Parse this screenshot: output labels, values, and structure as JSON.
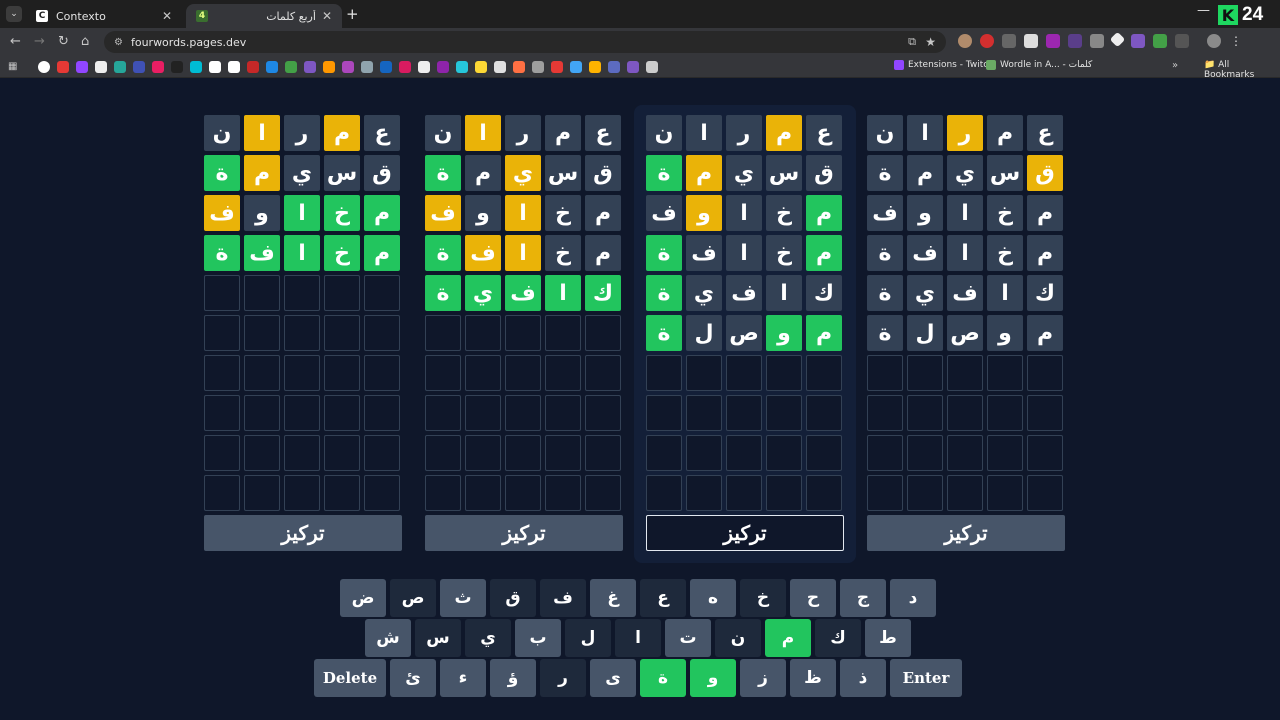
{
  "browser": {
    "tabs": [
      {
        "title": "Contexto",
        "favicon": "C",
        "active": false
      },
      {
        "title": "أربع كلمات",
        "favicon": "4",
        "active": true
      }
    ],
    "url": "fourwords.pages.dev",
    "brand_badge": {
      "letter": "K",
      "number": "24"
    },
    "bookmarks": [
      {
        "label": "Extensions - Twitch"
      },
      {
        "label": "Wordle in A... - كلمات"
      }
    ],
    "all_bookmarks": "All Bookmarks"
  },
  "colors": {
    "correct": "#22c55e",
    "present": "#eab308",
    "absent": "#334155",
    "background": "#0f172a"
  },
  "boards": [
    {
      "focus_label": "تركيز",
      "focused": false,
      "rows": [
        [
          {
            "l": "ن",
            "s": "absent"
          },
          {
            "l": "ا",
            "s": "present"
          },
          {
            "l": "ر",
            "s": "absent"
          },
          {
            "l": "م",
            "s": "present"
          },
          {
            "l": "ع",
            "s": "absent"
          }
        ],
        [
          {
            "l": "ة",
            "s": "correct"
          },
          {
            "l": "م",
            "s": "present"
          },
          {
            "l": "ي",
            "s": "absent"
          },
          {
            "l": "س",
            "s": "absent"
          },
          {
            "l": "ق",
            "s": "absent"
          }
        ],
        [
          {
            "l": "ف",
            "s": "present"
          },
          {
            "l": "و",
            "s": "absent"
          },
          {
            "l": "ا",
            "s": "correct"
          },
          {
            "l": "خ",
            "s": "correct"
          },
          {
            "l": "م",
            "s": "correct"
          }
        ],
        [
          {
            "l": "ة",
            "s": "correct"
          },
          {
            "l": "ف",
            "s": "correct"
          },
          {
            "l": "ا",
            "s": "correct"
          },
          {
            "l": "خ",
            "s": "correct"
          },
          {
            "l": "م",
            "s": "correct"
          }
        ]
      ]
    },
    {
      "focus_label": "تركيز",
      "focused": false,
      "rows": [
        [
          {
            "l": "ن",
            "s": "absent"
          },
          {
            "l": "ا",
            "s": "present"
          },
          {
            "l": "ر",
            "s": "absent"
          },
          {
            "l": "م",
            "s": "absent"
          },
          {
            "l": "ع",
            "s": "absent"
          }
        ],
        [
          {
            "l": "ة",
            "s": "correct"
          },
          {
            "l": "م",
            "s": "absent"
          },
          {
            "l": "ي",
            "s": "present"
          },
          {
            "l": "س",
            "s": "absent"
          },
          {
            "l": "ق",
            "s": "absent"
          }
        ],
        [
          {
            "l": "ف",
            "s": "present"
          },
          {
            "l": "و",
            "s": "absent"
          },
          {
            "l": "ا",
            "s": "present"
          },
          {
            "l": "خ",
            "s": "absent"
          },
          {
            "l": "م",
            "s": "absent"
          }
        ],
        [
          {
            "l": "ة",
            "s": "correct"
          },
          {
            "l": "ف",
            "s": "present"
          },
          {
            "l": "ا",
            "s": "present"
          },
          {
            "l": "خ",
            "s": "absent"
          },
          {
            "l": "م",
            "s": "absent"
          }
        ],
        [
          {
            "l": "ة",
            "s": "correct"
          },
          {
            "l": "ي",
            "s": "correct"
          },
          {
            "l": "ف",
            "s": "correct"
          },
          {
            "l": "ا",
            "s": "correct"
          },
          {
            "l": "ك",
            "s": "correct"
          }
        ]
      ]
    },
    {
      "focus_label": "تركيز",
      "focused": true,
      "rows": [
        [
          {
            "l": "ن",
            "s": "absent"
          },
          {
            "l": "ا",
            "s": "absent"
          },
          {
            "l": "ر",
            "s": "absent"
          },
          {
            "l": "م",
            "s": "present"
          },
          {
            "l": "ع",
            "s": "absent"
          }
        ],
        [
          {
            "l": "ة",
            "s": "correct"
          },
          {
            "l": "م",
            "s": "present"
          },
          {
            "l": "ي",
            "s": "absent"
          },
          {
            "l": "س",
            "s": "absent"
          },
          {
            "l": "ق",
            "s": "absent"
          }
        ],
        [
          {
            "l": "ف",
            "s": "absent"
          },
          {
            "l": "و",
            "s": "present"
          },
          {
            "l": "ا",
            "s": "absent"
          },
          {
            "l": "خ",
            "s": "absent"
          },
          {
            "l": "م",
            "s": "correct"
          }
        ],
        [
          {
            "l": "ة",
            "s": "correct"
          },
          {
            "l": "ف",
            "s": "absent"
          },
          {
            "l": "ا",
            "s": "absent"
          },
          {
            "l": "خ",
            "s": "absent"
          },
          {
            "l": "م",
            "s": "correct"
          }
        ],
        [
          {
            "l": "ة",
            "s": "correct"
          },
          {
            "l": "ي",
            "s": "absent"
          },
          {
            "l": "ف",
            "s": "absent"
          },
          {
            "l": "ا",
            "s": "absent"
          },
          {
            "l": "ك",
            "s": "absent"
          }
        ],
        [
          {
            "l": "ة",
            "s": "correct"
          },
          {
            "l": "ل",
            "s": "absent"
          },
          {
            "l": "ص",
            "s": "absent"
          },
          {
            "l": "و",
            "s": "correct"
          },
          {
            "l": "م",
            "s": "correct"
          }
        ]
      ]
    },
    {
      "focus_label": "تركيز",
      "focused": false,
      "rows": [
        [
          {
            "l": "ن",
            "s": "absent"
          },
          {
            "l": "ا",
            "s": "absent"
          },
          {
            "l": "ر",
            "s": "present"
          },
          {
            "l": "م",
            "s": "absent"
          },
          {
            "l": "ع",
            "s": "absent"
          }
        ],
        [
          {
            "l": "ة",
            "s": "absent"
          },
          {
            "l": "م",
            "s": "absent"
          },
          {
            "l": "ي",
            "s": "absent"
          },
          {
            "l": "س",
            "s": "absent"
          },
          {
            "l": "ق",
            "s": "present"
          }
        ],
        [
          {
            "l": "ف",
            "s": "absent"
          },
          {
            "l": "و",
            "s": "absent"
          },
          {
            "l": "ا",
            "s": "absent"
          },
          {
            "l": "خ",
            "s": "absent"
          },
          {
            "l": "م",
            "s": "absent"
          }
        ],
        [
          {
            "l": "ة",
            "s": "absent"
          },
          {
            "l": "ف",
            "s": "absent"
          },
          {
            "l": "ا",
            "s": "absent"
          },
          {
            "l": "خ",
            "s": "absent"
          },
          {
            "l": "م",
            "s": "absent"
          }
        ],
        [
          {
            "l": "ة",
            "s": "absent"
          },
          {
            "l": "ي",
            "s": "absent"
          },
          {
            "l": "ف",
            "s": "absent"
          },
          {
            "l": "ا",
            "s": "absent"
          },
          {
            "l": "ك",
            "s": "absent"
          }
        ],
        [
          {
            "l": "ة",
            "s": "absent"
          },
          {
            "l": "ل",
            "s": "absent"
          },
          {
            "l": "ص",
            "s": "absent"
          },
          {
            "l": "و",
            "s": "absent"
          },
          {
            "l": "م",
            "s": "absent"
          }
        ]
      ]
    }
  ],
  "keyboard": {
    "rows": [
      [
        {
          "k": "ض",
          "s": "absent"
        },
        {
          "k": "ص",
          "s": "none"
        },
        {
          "k": "ث",
          "s": "absent"
        },
        {
          "k": "ق",
          "s": "none"
        },
        {
          "k": "ف",
          "s": "none"
        },
        {
          "k": "غ",
          "s": "absent"
        },
        {
          "k": "ع",
          "s": "none"
        },
        {
          "k": "ه",
          "s": "absent"
        },
        {
          "k": "خ",
          "s": "none"
        },
        {
          "k": "ح",
          "s": "absent"
        },
        {
          "k": "ج",
          "s": "absent"
        },
        {
          "k": "د",
          "s": "absent"
        }
      ],
      [
        {
          "k": "ش",
          "s": "absent"
        },
        {
          "k": "س",
          "s": "none"
        },
        {
          "k": "ي",
          "s": "none"
        },
        {
          "k": "ب",
          "s": "absent"
        },
        {
          "k": "ل",
          "s": "none"
        },
        {
          "k": "ا",
          "s": "none"
        },
        {
          "k": "ت",
          "s": "absent"
        },
        {
          "k": "ن",
          "s": "none"
        },
        {
          "k": "م",
          "s": "correct"
        },
        {
          "k": "ك",
          "s": "none"
        },
        {
          "k": "ط",
          "s": "absent"
        }
      ],
      [
        {
          "k": "Delete",
          "s": "wide"
        },
        {
          "k": "ئ",
          "s": "absent"
        },
        {
          "k": "ء",
          "s": "absent"
        },
        {
          "k": "ؤ",
          "s": "absent"
        },
        {
          "k": "ر",
          "s": "none"
        },
        {
          "k": "ى",
          "s": "absent"
        },
        {
          "k": "ة",
          "s": "correct"
        },
        {
          "k": "و",
          "s": "correct"
        },
        {
          "k": "ز",
          "s": "absent"
        },
        {
          "k": "ظ",
          "s": "absent"
        },
        {
          "k": "ذ",
          "s": "absent"
        },
        {
          "k": "Enter",
          "s": "wide"
        }
      ]
    ]
  }
}
